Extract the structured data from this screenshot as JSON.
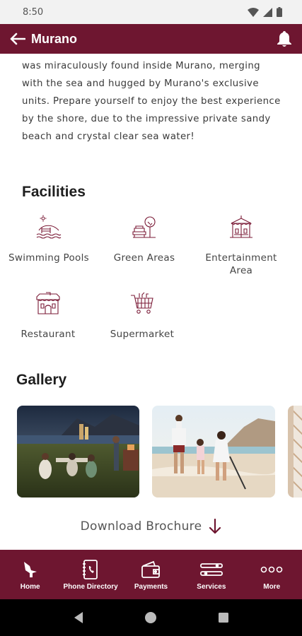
{
  "status_bar": {
    "time": "8:50"
  },
  "app_bar": {
    "title": "Murano"
  },
  "intro": {
    "text": "was miraculously found inside Murano, merging with the sea and hugged by Murano's exclusive units. Prepare yourself to enjoy the best experience by the shore, due to the impressive private sandy beach and crystal clear sea water!"
  },
  "facilities": {
    "title": "Facilities",
    "items": [
      {
        "label": "Swimming Pools",
        "icon": "swimming-pool-icon"
      },
      {
        "label": "Green Areas",
        "icon": "green-areas-icon"
      },
      {
        "label": "Entertainment Area",
        "icon": "entertainment-icon"
      },
      {
        "label": "Restaurant",
        "icon": "restaurant-icon"
      },
      {
        "label": "Supermarket",
        "icon": "supermarket-cart-icon"
      }
    ]
  },
  "gallery": {
    "title": "Gallery"
  },
  "brochure": {
    "label": "Download Brochure"
  },
  "bottom_nav": {
    "items": [
      {
        "label": "Home",
        "icon": "home-bird-icon"
      },
      {
        "label": "Phone Directory",
        "icon": "phone-book-icon"
      },
      {
        "label": "Payments",
        "icon": "wallet-icon"
      },
      {
        "label": "Services",
        "icon": "tools-icon"
      },
      {
        "label": "More",
        "icon": "more-dots-icon"
      }
    ]
  },
  "colors": {
    "brand": "#6e1630",
    "icon_line": "#7a1a36",
    "text": "#3a3a3a"
  }
}
